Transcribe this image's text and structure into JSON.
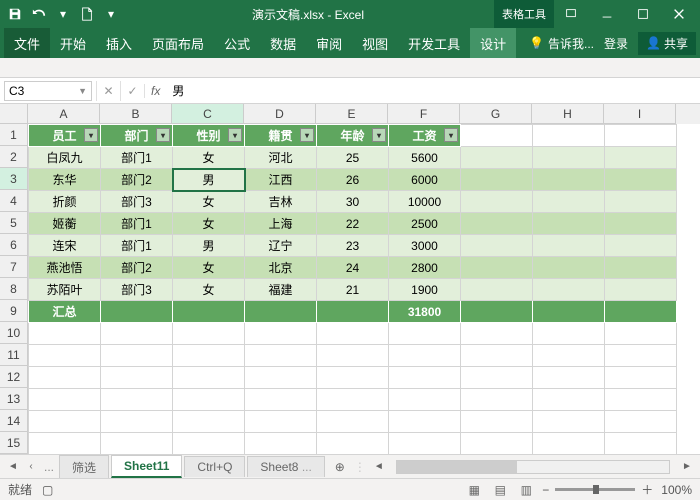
{
  "title": "演示文稿.xlsx - Excel",
  "context_tab": "表格工具",
  "ribbon": {
    "file": "文件",
    "tabs": [
      "开始",
      "插入",
      "页面布局",
      "公式",
      "数据",
      "审阅",
      "视图",
      "开发工具",
      "设计"
    ],
    "active": "设计",
    "tell_me": "告诉我...",
    "signin": "登录",
    "share": "共享"
  },
  "name_box": "C3",
  "formula_value": "男",
  "columns": [
    "A",
    "B",
    "C",
    "D",
    "E",
    "F",
    "G",
    "H",
    "I"
  ],
  "rows": [
    "1",
    "2",
    "3",
    "4",
    "5",
    "6",
    "7",
    "8",
    "9",
    "10",
    "11",
    "12",
    "13",
    "14",
    "15"
  ],
  "headers": [
    "员工",
    "部门",
    "性别",
    "籍贯",
    "年龄",
    "工资"
  ],
  "data_rows": [
    [
      "白凤九",
      "部门1",
      "女",
      "河北",
      "25",
      "5600"
    ],
    [
      "东华",
      "部门2",
      "男",
      "江西",
      "26",
      "6000"
    ],
    [
      "折颜",
      "部门3",
      "女",
      "吉林",
      "30",
      "10000"
    ],
    [
      "姬蘅",
      "部门1",
      "女",
      "上海",
      "22",
      "2500"
    ],
    [
      "连宋",
      "部门1",
      "男",
      "辽宁",
      "23",
      "3000"
    ],
    [
      "燕池悟",
      "部门2",
      "女",
      "北京",
      "24",
      "2800"
    ],
    [
      "苏陌叶",
      "部门3",
      "女",
      "福建",
      "21",
      "1900"
    ]
  ],
  "total_label": "汇总",
  "total_value": "31800",
  "sheet_tabs": {
    "nav_prev_dots": "...",
    "filter": "筛选",
    "active": "Sheet11",
    "ctrl_q": "Ctrl+Q",
    "sheet8": "Sheet8",
    "sheet8_dots": "..."
  },
  "status": {
    "ready": "就绪",
    "record": "",
    "zoom": "100%"
  }
}
